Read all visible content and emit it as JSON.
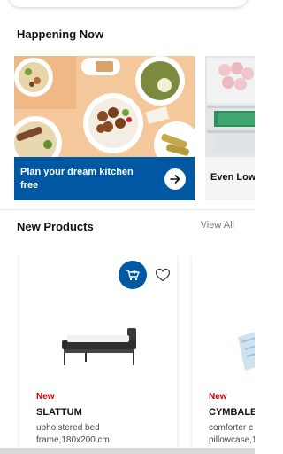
{
  "happening": {
    "title": "Happening Now",
    "cards": [
      {
        "label": "Plan your dream kitchen free"
      },
      {
        "label": "Even Low"
      }
    ]
  },
  "new_products": {
    "title": "New Products",
    "view_all": "View All",
    "items": [
      {
        "badge": "New",
        "name": "SLATTUM",
        "description": "upholstered bed frame,180x200 cm"
      },
      {
        "badge": "New",
        "name": "CYMBALB",
        "description": "comforter c\npillowcase,1"
      }
    ]
  },
  "colors": {
    "accent_blue": "#0058a3",
    "new_badge_red": "#cc0008"
  },
  "icons": [
    "arrow-right-icon",
    "add-to-cart-icon",
    "heart-icon"
  ]
}
